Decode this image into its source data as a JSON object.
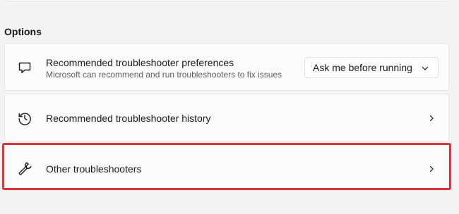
{
  "section": {
    "title": "Options"
  },
  "items": [
    {
      "title": "Recommended troubleshooter preferences",
      "subtitle": "Microsoft can recommend and run troubleshooters to fix issues",
      "icon": "chat-bubble-icon",
      "control": {
        "type": "dropdown",
        "value": "Ask me before running",
        "icon": "chevron-down-icon"
      }
    },
    {
      "title": "Recommended troubleshooter history",
      "icon": "history-icon",
      "control": {
        "type": "navigate",
        "icon": "chevron-right-icon"
      }
    },
    {
      "title": "Other troubleshooters",
      "icon": "wrench-icon",
      "control": {
        "type": "navigate",
        "icon": "chevron-right-icon"
      },
      "highlighted": true
    }
  ],
  "colors": {
    "background": "#f3f3f3",
    "card": "#fbfbfb",
    "highlight": "#d9363e"
  }
}
